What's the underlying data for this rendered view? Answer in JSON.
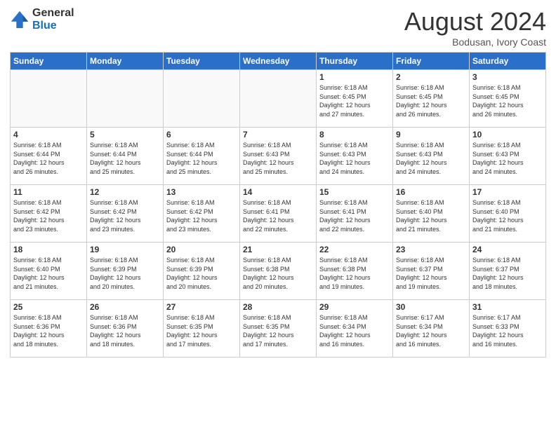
{
  "logo": {
    "general": "General",
    "blue": "Blue"
  },
  "title": "August 2024",
  "subtitle": "Bodusan, Ivory Coast",
  "days_of_week": [
    "Sunday",
    "Monday",
    "Tuesday",
    "Wednesday",
    "Thursday",
    "Friday",
    "Saturday"
  ],
  "weeks": [
    [
      {
        "day": "",
        "info": ""
      },
      {
        "day": "",
        "info": ""
      },
      {
        "day": "",
        "info": ""
      },
      {
        "day": "",
        "info": ""
      },
      {
        "day": "1",
        "info": "Sunrise: 6:18 AM\nSunset: 6:45 PM\nDaylight: 12 hours\nand 27 minutes."
      },
      {
        "day": "2",
        "info": "Sunrise: 6:18 AM\nSunset: 6:45 PM\nDaylight: 12 hours\nand 26 minutes."
      },
      {
        "day": "3",
        "info": "Sunrise: 6:18 AM\nSunset: 6:45 PM\nDaylight: 12 hours\nand 26 minutes."
      }
    ],
    [
      {
        "day": "4",
        "info": "Sunrise: 6:18 AM\nSunset: 6:44 PM\nDaylight: 12 hours\nand 26 minutes."
      },
      {
        "day": "5",
        "info": "Sunrise: 6:18 AM\nSunset: 6:44 PM\nDaylight: 12 hours\nand 25 minutes."
      },
      {
        "day": "6",
        "info": "Sunrise: 6:18 AM\nSunset: 6:44 PM\nDaylight: 12 hours\nand 25 minutes."
      },
      {
        "day": "7",
        "info": "Sunrise: 6:18 AM\nSunset: 6:43 PM\nDaylight: 12 hours\nand 25 minutes."
      },
      {
        "day": "8",
        "info": "Sunrise: 6:18 AM\nSunset: 6:43 PM\nDaylight: 12 hours\nand 24 minutes."
      },
      {
        "day": "9",
        "info": "Sunrise: 6:18 AM\nSunset: 6:43 PM\nDaylight: 12 hours\nand 24 minutes."
      },
      {
        "day": "10",
        "info": "Sunrise: 6:18 AM\nSunset: 6:43 PM\nDaylight: 12 hours\nand 24 minutes."
      }
    ],
    [
      {
        "day": "11",
        "info": "Sunrise: 6:18 AM\nSunset: 6:42 PM\nDaylight: 12 hours\nand 23 minutes."
      },
      {
        "day": "12",
        "info": "Sunrise: 6:18 AM\nSunset: 6:42 PM\nDaylight: 12 hours\nand 23 minutes."
      },
      {
        "day": "13",
        "info": "Sunrise: 6:18 AM\nSunset: 6:42 PM\nDaylight: 12 hours\nand 23 minutes."
      },
      {
        "day": "14",
        "info": "Sunrise: 6:18 AM\nSunset: 6:41 PM\nDaylight: 12 hours\nand 22 minutes."
      },
      {
        "day": "15",
        "info": "Sunrise: 6:18 AM\nSunset: 6:41 PM\nDaylight: 12 hours\nand 22 minutes."
      },
      {
        "day": "16",
        "info": "Sunrise: 6:18 AM\nSunset: 6:40 PM\nDaylight: 12 hours\nand 21 minutes."
      },
      {
        "day": "17",
        "info": "Sunrise: 6:18 AM\nSunset: 6:40 PM\nDaylight: 12 hours\nand 21 minutes."
      }
    ],
    [
      {
        "day": "18",
        "info": "Sunrise: 6:18 AM\nSunset: 6:40 PM\nDaylight: 12 hours\nand 21 minutes."
      },
      {
        "day": "19",
        "info": "Sunrise: 6:18 AM\nSunset: 6:39 PM\nDaylight: 12 hours\nand 20 minutes."
      },
      {
        "day": "20",
        "info": "Sunrise: 6:18 AM\nSunset: 6:39 PM\nDaylight: 12 hours\nand 20 minutes."
      },
      {
        "day": "21",
        "info": "Sunrise: 6:18 AM\nSunset: 6:38 PM\nDaylight: 12 hours\nand 20 minutes."
      },
      {
        "day": "22",
        "info": "Sunrise: 6:18 AM\nSunset: 6:38 PM\nDaylight: 12 hours\nand 19 minutes."
      },
      {
        "day": "23",
        "info": "Sunrise: 6:18 AM\nSunset: 6:37 PM\nDaylight: 12 hours\nand 19 minutes."
      },
      {
        "day": "24",
        "info": "Sunrise: 6:18 AM\nSunset: 6:37 PM\nDaylight: 12 hours\nand 18 minutes."
      }
    ],
    [
      {
        "day": "25",
        "info": "Sunrise: 6:18 AM\nSunset: 6:36 PM\nDaylight: 12 hours\nand 18 minutes."
      },
      {
        "day": "26",
        "info": "Sunrise: 6:18 AM\nSunset: 6:36 PM\nDaylight: 12 hours\nand 18 minutes."
      },
      {
        "day": "27",
        "info": "Sunrise: 6:18 AM\nSunset: 6:35 PM\nDaylight: 12 hours\nand 17 minutes."
      },
      {
        "day": "28",
        "info": "Sunrise: 6:18 AM\nSunset: 6:35 PM\nDaylight: 12 hours\nand 17 minutes."
      },
      {
        "day": "29",
        "info": "Sunrise: 6:18 AM\nSunset: 6:34 PM\nDaylight: 12 hours\nand 16 minutes."
      },
      {
        "day": "30",
        "info": "Sunrise: 6:17 AM\nSunset: 6:34 PM\nDaylight: 12 hours\nand 16 minutes."
      },
      {
        "day": "31",
        "info": "Sunrise: 6:17 AM\nSunset: 6:33 PM\nDaylight: 12 hours\nand 16 minutes."
      }
    ]
  ]
}
